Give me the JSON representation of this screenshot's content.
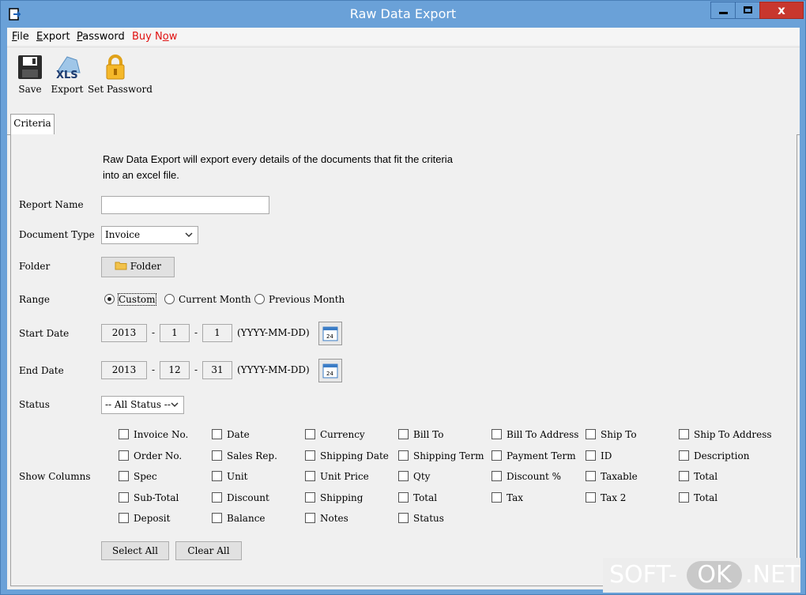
{
  "window": {
    "title": "Raw Data Export",
    "close_glyph": "x"
  },
  "menu": [
    {
      "label": "File",
      "mnemonic": "F",
      "rest": "ile"
    },
    {
      "label": "Export",
      "mnemonic": "E",
      "rest": "xport"
    },
    {
      "label": "Password",
      "mnemonic": "P",
      "rest": "assword"
    },
    {
      "label": "Buy Now",
      "pre": "Buy N",
      "mnemonic": "o",
      "rest": "w",
      "color": "#e01010"
    }
  ],
  "toolbar": {
    "save": "Save",
    "export": "Export",
    "export_icon_text": "XLS",
    "set_password": "Set Password"
  },
  "tabs": {
    "criteria": "Criteria"
  },
  "form": {
    "description_line1": "Raw Data Export will export every details of the documents that fit the criteria",
    "description_line2": "into an excel file.",
    "report_name_label": "Report Name",
    "report_name_value": "",
    "document_type_label": "Document Type",
    "document_type_value": "Invoice",
    "folder_label": "Folder",
    "folder_button": "Folder",
    "range_label": "Range",
    "range_options": [
      "Custom",
      "Current Month",
      "Previous Month"
    ],
    "range_selected": "Custom",
    "start_date_label": "Start Date",
    "start_date": {
      "year": "2013",
      "month": "1",
      "day": "1"
    },
    "end_date_label": "End Date",
    "end_date": {
      "year": "2013",
      "month": "12",
      "day": "31"
    },
    "date_separator": "-",
    "calendar_day": "24",
    "date_format": "(YYYY-MM-DD)",
    "status_label": "Status",
    "status_value": "-- All Status --",
    "show_columns_label": "Show Columns",
    "select_all": "Select All",
    "clear_all": "Clear All"
  },
  "columns": [
    [
      "Invoice No.",
      "Date",
      "Currency",
      "Bill To",
      "Bill To Address",
      "Ship To",
      "Ship To Address"
    ],
    [
      "Order No.",
      "Sales Rep.",
      "Shipping Date",
      "Shipping Term",
      "Payment Term",
      "ID",
      "Description"
    ],
    [
      "Spec",
      "Unit",
      "Unit Price",
      "Qty",
      "Discount %",
      "Taxable",
      "Total"
    ],
    [
      "Sub-Total",
      "Discount",
      "Shipping",
      "Total",
      "Tax",
      "Tax 2",
      "Total"
    ],
    [
      "Deposit",
      "Balance",
      "Notes",
      "Status"
    ]
  ],
  "watermark": {
    "left": "SOFT-",
    "ok": "OK",
    "right": ".NET"
  }
}
